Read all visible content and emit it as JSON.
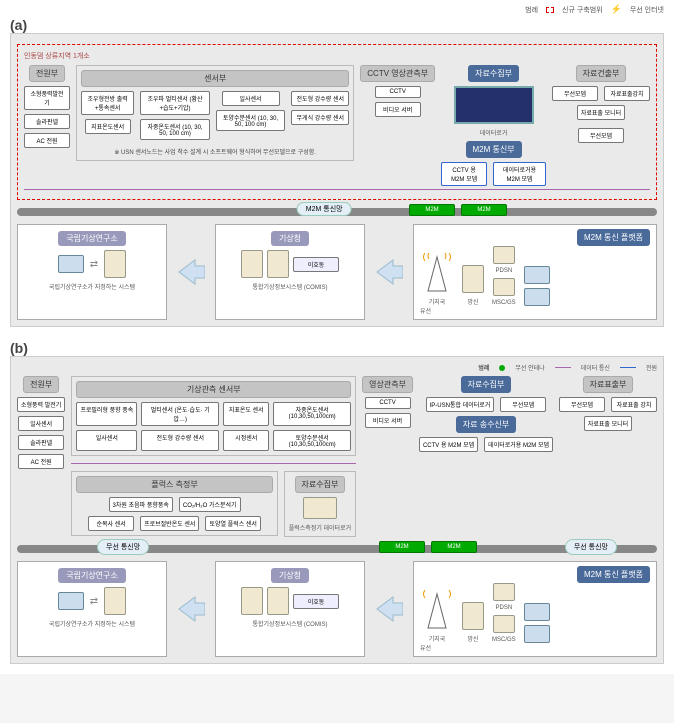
{
  "figure_a": {
    "label": "(a)",
    "legend_top": {
      "title": "범례",
      "new_area": "신규 구축범위",
      "wireless": "무선 인터넷"
    },
    "site_title": "인동댐 상류지역 1개소",
    "power": {
      "title": "전원부",
      "items": [
        "소형풍력발전기",
        "솔라판넬",
        "AC 전원"
      ]
    },
    "sensor": {
      "title": "센서부",
      "group1": [
        "조우형전방 출력+통속센서",
        "지표온도센서"
      ],
      "group2": [
        "조우파 멀티센서 (황산+습도+기압)",
        "자중온도센서 (10, 30, 50, 100 cm)"
      ],
      "group3": [
        "일사센서",
        "토양수분센서 (10, 30, 50, 100 cm)"
      ],
      "group4": [
        "전도형 강수량 센서",
        "무게식 강수량 센서"
      ],
      "note": "※ USN 센서노드는 사업 착수 설계 시 소프트웨어 형식하여 무선모델으로 구성함."
    },
    "cctv": {
      "title": "CCTV 영상관측부",
      "items": [
        "CCTV",
        "비디오 서버"
      ]
    },
    "acq": {
      "title": "자료수집부",
      "datalogger": "데이터로거",
      "modem": "무선모뎀"
    },
    "m2m_comm": {
      "title": "M2M 통신부",
      "items": [
        "CCTV 용 M2M 모뎀",
        "데이터로거용 M2M 모뎀"
      ]
    },
    "out": {
      "title": "자료건출부",
      "items": [
        "무선모뎀",
        "자료표출강치",
        "자료표출 모니터"
      ]
    },
    "network_bar": "M2M 통신망",
    "m2m_badges": [
      "M2M",
      "M2M"
    ],
    "dest1": {
      "title": "국립기상연구소",
      "caption": "국립기상연구소가 지정하는 시스템"
    },
    "dest2": {
      "title": "기상청",
      "caption": "통합기상정보시스템 (COMIS)",
      "chip": "이호동"
    },
    "m2m_platform": {
      "title": "M2M 통신 플랫폼",
      "labels": [
        "기지국",
        "망신",
        "PDSN",
        "유선",
        "MSC/GS"
      ]
    }
  },
  "figure_b": {
    "label": "(b)",
    "legend": {
      "title": "범례",
      "antenna": "무선 안테나",
      "data_line": "데이터 통신",
      "power_line": "전원"
    },
    "power": {
      "title": "전원부",
      "items": [
        "소형풍력 발전기",
        "일사센서",
        "솔라판넬",
        "AC 전원"
      ]
    },
    "met": {
      "title": "기상관측 센서부",
      "row1": [
        "프로필러형 풍향 풍속",
        "멀티센서 (온도·습도· 기압…)",
        "지표온도 센서",
        "자중온도센서 (10,30,50,100cm)"
      ],
      "row2": [
        "일사센서",
        "전도형 강수량 센서",
        "시정센서",
        "토양수분센서 (10,30,50,100cm)"
      ]
    },
    "flux": {
      "title": "플럭스 측정부",
      "row1": [
        "3차원 초음파 풍향풍속",
        "CO₂/H₂O 가스분석기"
      ],
      "row2": [
        "순복사 센서",
        "프로브절반온도 센서",
        "토양열 플럭스 센서"
      ]
    },
    "img": {
      "title": "영상관측부",
      "items": [
        "CCTV",
        "비디오 서버"
      ]
    },
    "acq1": {
      "title": "자료수집부",
      "item": "IP-USN통합 데이터로거",
      "modem": "무선모뎀"
    },
    "acq2": {
      "title": "자료수집부",
      "item": "플럭스측정기 데이터로거"
    },
    "out": {
      "title": "자료표출부",
      "items": [
        "무선모뎀",
        "자료표출 강치",
        "자료표출 모니터"
      ]
    },
    "tx": {
      "title": "자료 송수신부",
      "items": [
        "CCTV 용 M2M 모뎀",
        "데이터로거용 M2M 모뎀"
      ]
    },
    "network_bar_left": "무선 통신망",
    "network_bar_right": "무선 통신망",
    "m2m_badges": [
      "M2M",
      "M2M"
    ],
    "dest1": {
      "title": "국립기상연구소",
      "caption": "국립기상연구소가 지정하는 시스템"
    },
    "dest2": {
      "title": "기상청",
      "caption": "통합기상정보시스템 (COMIS)",
      "chip": "이호동"
    },
    "m2m_platform": {
      "title": "M2M 통신 플랫폼",
      "labels": [
        "기지국",
        "망신",
        "PDSN",
        "유선",
        "MSC/GS"
      ]
    }
  }
}
